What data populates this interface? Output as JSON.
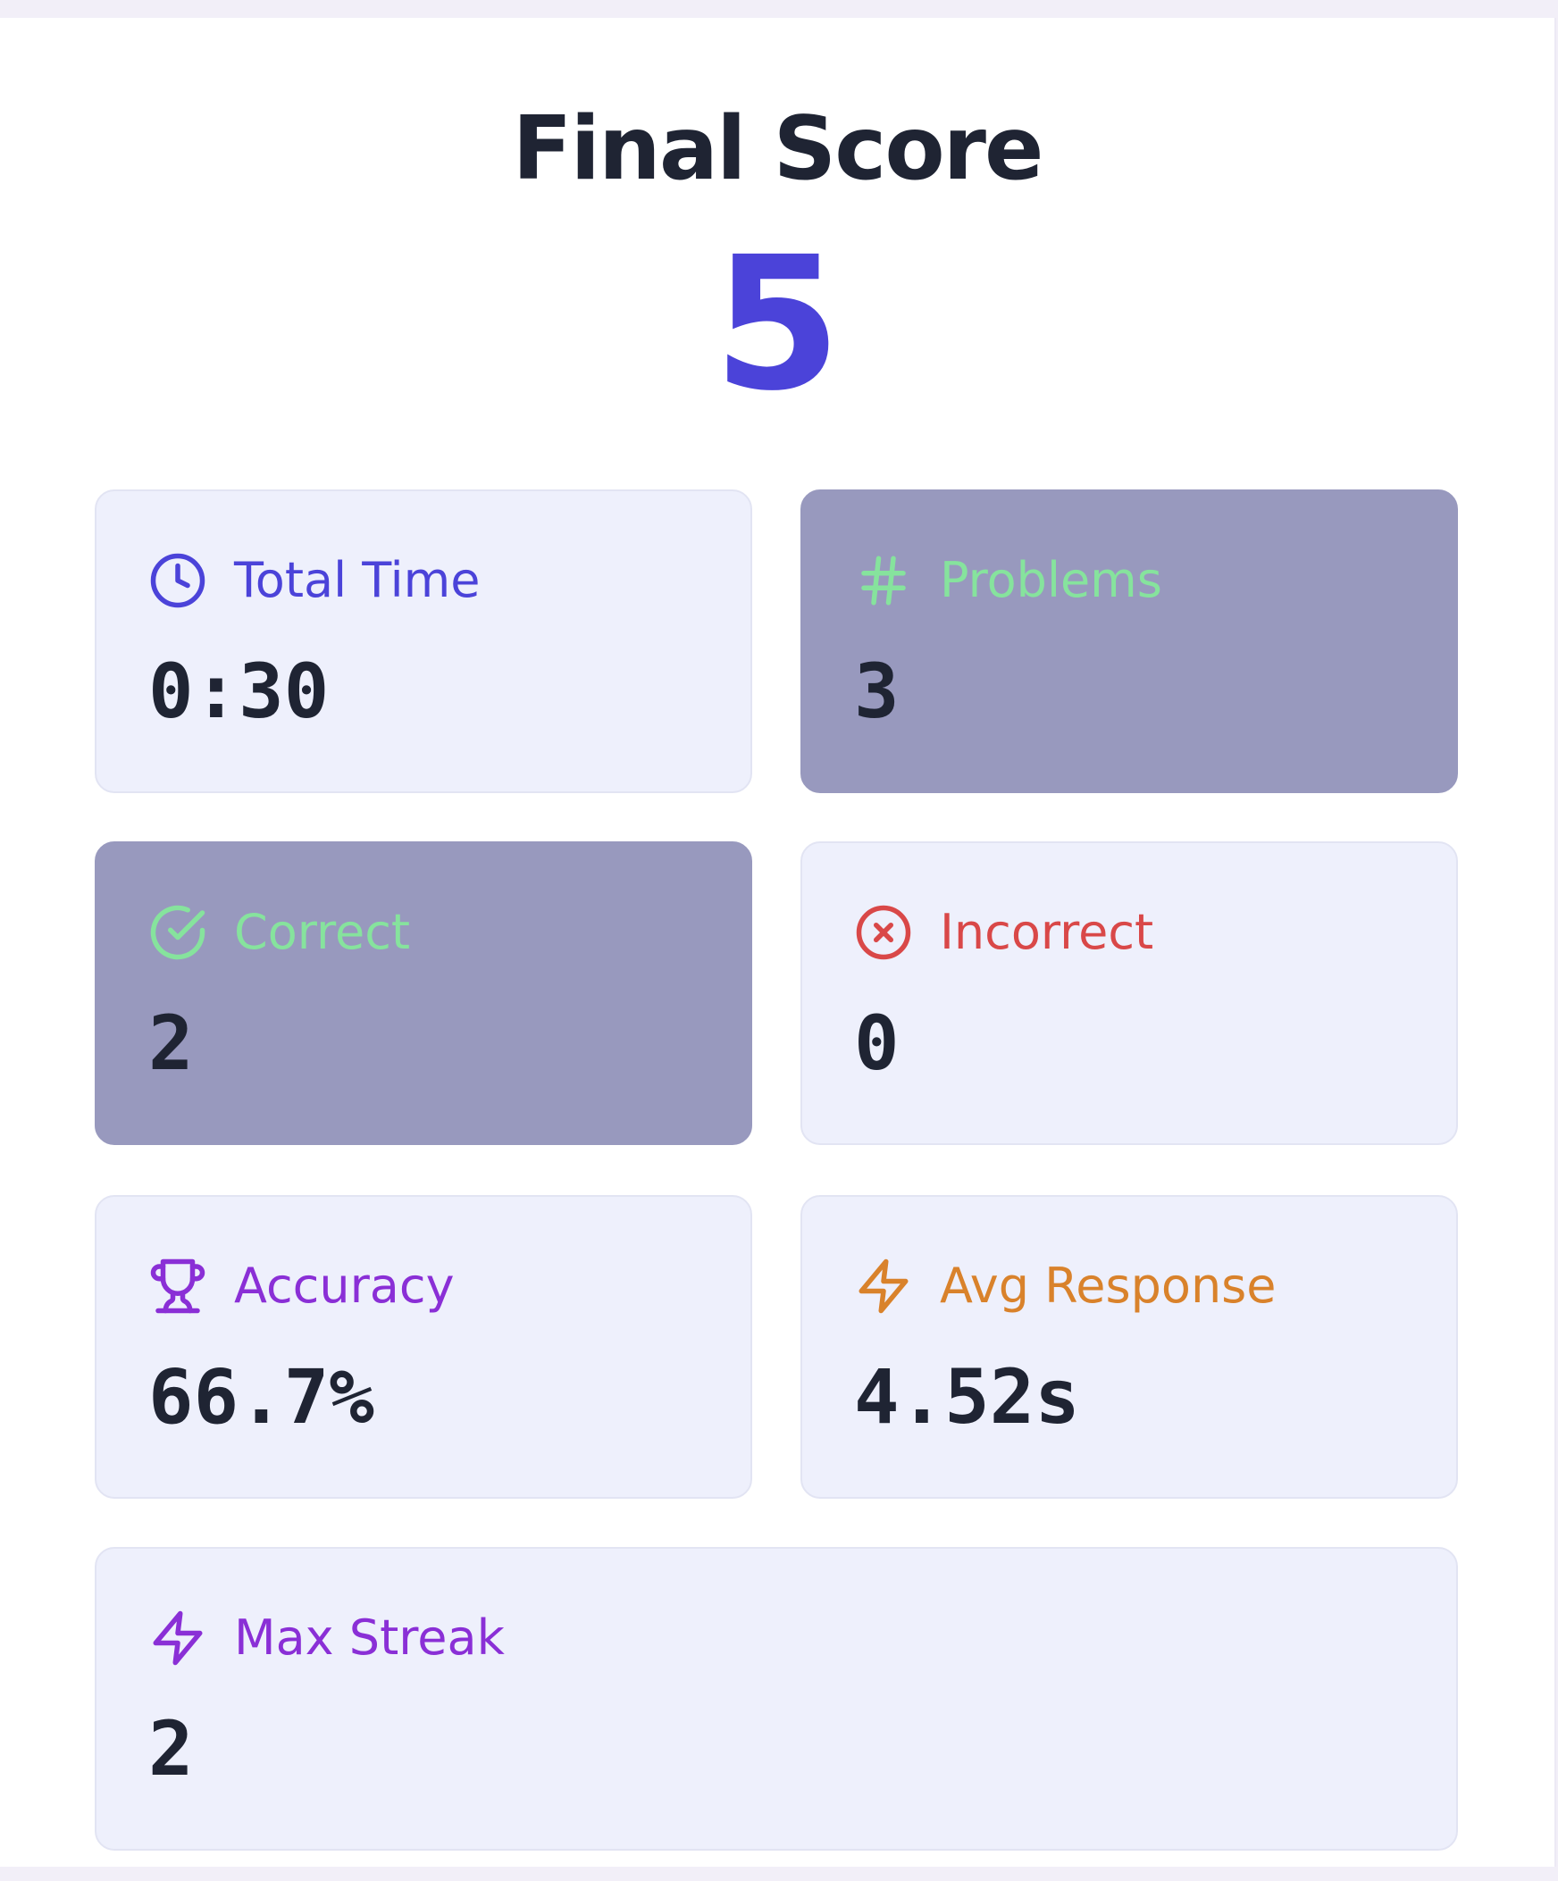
{
  "header": {
    "title": "Final Score",
    "score": "5"
  },
  "stats": {
    "total_time": {
      "label": "Total Time",
      "value": "0:30",
      "icon": "clock-icon",
      "color": "#4b43d9"
    },
    "problems": {
      "label": "Problems",
      "value": "3",
      "icon": "hash-icon",
      "color": "#86e39d"
    },
    "correct": {
      "label": "Correct",
      "value": "2",
      "icon": "check-circle-icon",
      "color": "#86e39d"
    },
    "incorrect": {
      "label": "Incorrect",
      "value": "0",
      "icon": "x-circle-icon",
      "color": "#d94848"
    },
    "accuracy": {
      "label": "Accuracy",
      "value": "66.7%",
      "icon": "trophy-icon",
      "color": "#8a2fd6"
    },
    "avg_response": {
      "label": "Avg Response",
      "value": "4.52s",
      "icon": "lightning-icon",
      "color": "#d9822b"
    },
    "max_streak": {
      "label": "Max Streak",
      "value": "2",
      "icon": "lightning-icon",
      "color": "#8a2fd6"
    }
  },
  "colors": {
    "accent": "#4b43d9",
    "card_bg": "#eef0fc",
    "card_highlight_bg": "#9899be",
    "text_dark": "#1f2433"
  }
}
